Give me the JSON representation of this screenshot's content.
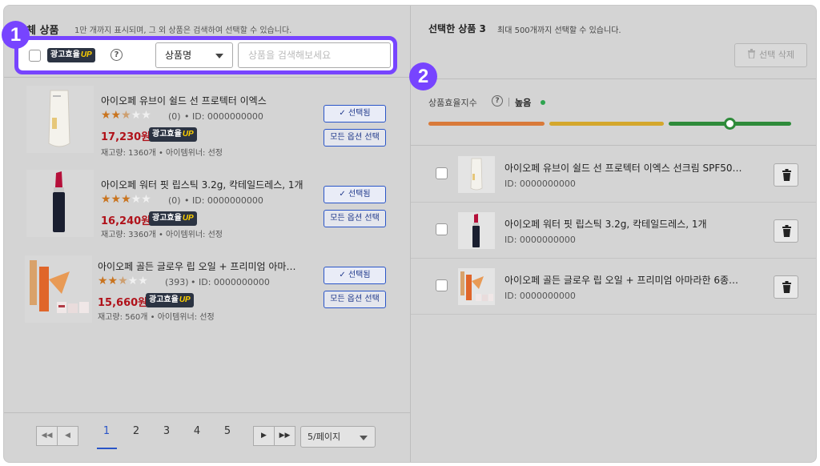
{
  "left_panel": {
    "title": "체 상품",
    "subtitle": "1만 개까지 표시되며, 그 외 상품은 검색하여 선택할 수 있습니다.",
    "filter": {
      "ad_badge_text": "광고효율",
      "ad_badge_up": "UP",
      "help_icon": "?",
      "select_value": "상품명",
      "search_placeholder": "상품을 검색해보세요"
    },
    "products": [
      {
        "name": "아이오페 유브이 쉴드 선 프로텍터 이엑스",
        "rating": 2.5,
        "stars_full": "★★",
        "stars_half": "★",
        "stars_empty": "★★",
        "reviews": "(0)",
        "id": "• ID: 0000000000",
        "price": "17,230원",
        "badge_text": "광고효율",
        "badge_up": "UP",
        "stock": "재고량: 1360개 • 아이템위너: 선정",
        "selected_label": "✓ 선택됨",
        "option_label": "모든 옵션 선택"
      },
      {
        "name": "아이오페 워터 핏 립스틱 3.2g, 칵테일드레스, 1개",
        "rating": 3,
        "stars_full": "★★★",
        "stars_half": "",
        "stars_empty": "★★",
        "reviews": "(0)",
        "id": "• ID: 0000000000",
        "price": "16,240원",
        "badge_text": "광고효율",
        "badge_up": "UP",
        "stock": "재고량: 3360개 • 아이템위너: 선정",
        "selected_label": "✓ 선택됨",
        "option_label": "모든 옵션 선택"
      },
      {
        "name": "아이오페 골든 글로우 립 오일 + 프리미엄 아마…",
        "rating": 2.5,
        "stars_full": "★★",
        "stars_half": "★",
        "stars_empty": "★★",
        "reviews": "(393)",
        "id": "• ID: 0000000000",
        "price": "15,660원",
        "badge_text": "광고효율",
        "badge_up": "UP",
        "stock": "재고량: 560개 • 아이템위너: 선정",
        "selected_label": "✓ 선택됨",
        "option_label": "모든 옵션 선택"
      }
    ],
    "pagination": {
      "first": "◀◀",
      "prev": "◀",
      "pages": [
        "1",
        "2",
        "3",
        "4",
        "5"
      ],
      "active_page": "1",
      "next": "▶",
      "last": "▶▶",
      "per_page": "5/페이지"
    }
  },
  "right_panel": {
    "title": "선택한 상품 3",
    "subtitle": "최대 500개까지 선택할 수 있습니다.",
    "delete_button": "선택 삭제",
    "efficiency_label": "상품효율지수",
    "efficiency_value": "높음",
    "efficiency_level_fraction": 0.84,
    "selected_items": [
      {
        "name": "아이오페 유브이 쉴드 선 프로텍터 이엑스 선크림 SPF50…",
        "id": "ID: 0000000000"
      },
      {
        "name": "아이오페 워터 핏 립스틱 3.2g, 칵테일드레스, 1개",
        "id": "ID: 0000000000"
      },
      {
        "name": "아이오페 골든 글로우 립 오일 + 프리미엄 아마라한 6종…",
        "id": "ID: 0000000000"
      }
    ]
  },
  "steps": [
    "1",
    "2"
  ],
  "colors": {
    "accent_purple": "#7744ff",
    "price_red": "#b0121a",
    "link_blue": "#2a55c7",
    "bar_orange": "#d97a3a",
    "bar_yellow": "#d4a72c",
    "bar_green": "#2e8b3a"
  }
}
